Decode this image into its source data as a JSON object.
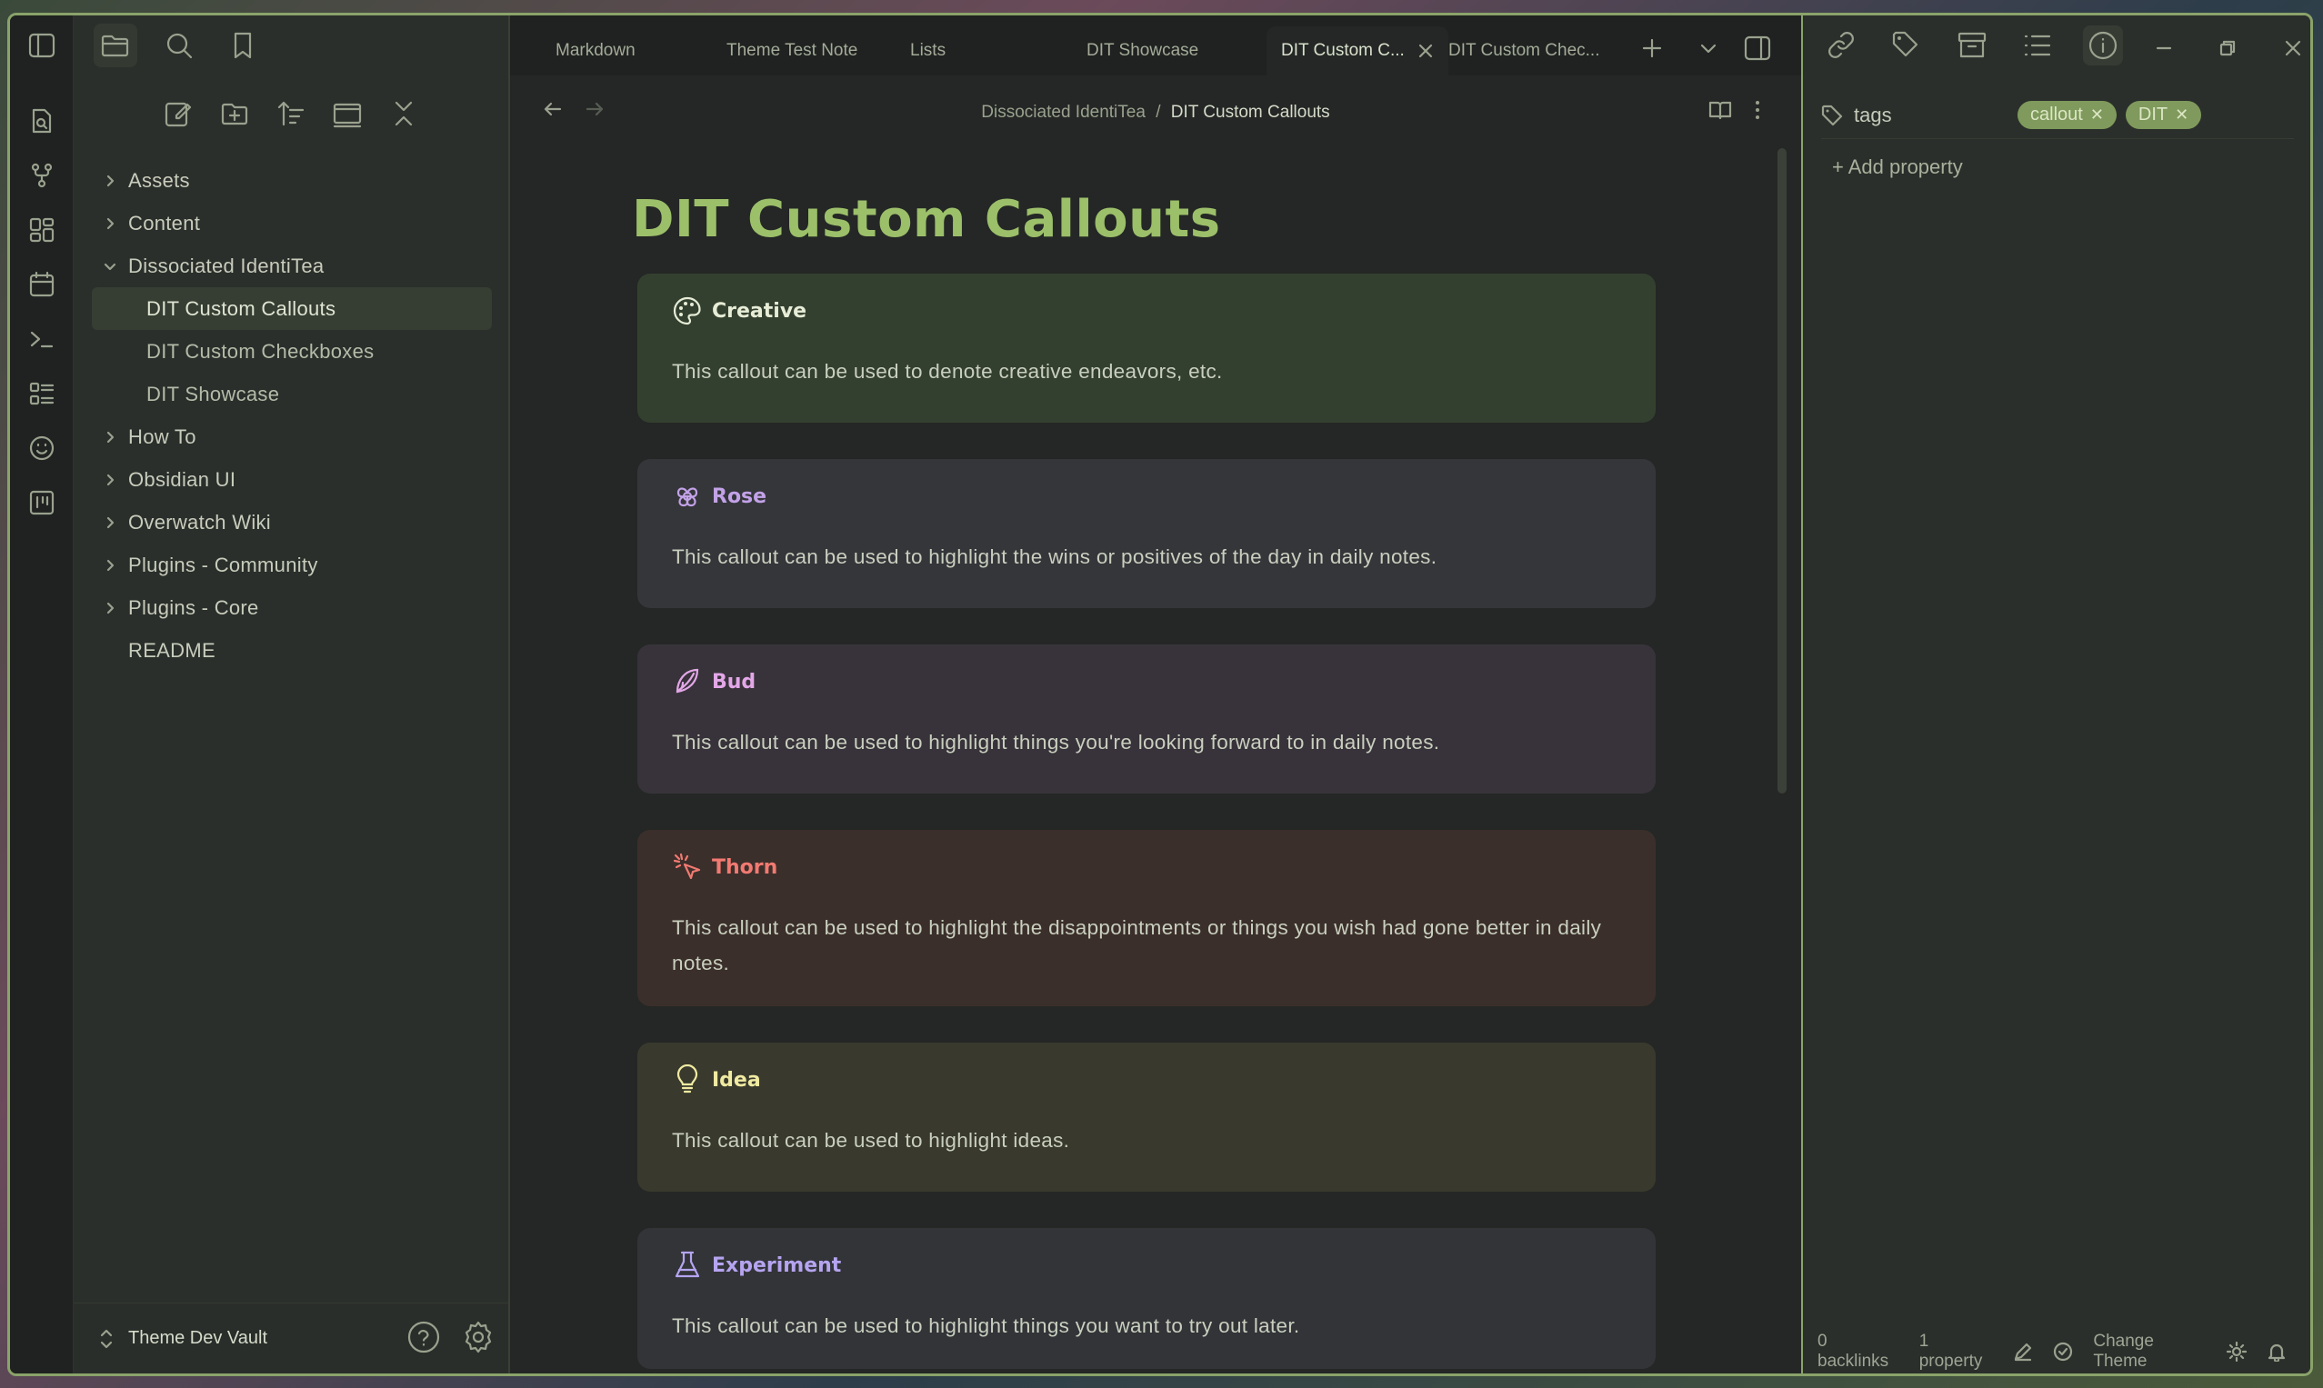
{
  "colors": {
    "accent": "#9cbf6a",
    "creative": "#e6ecd6",
    "rose": "#c3a2e8",
    "bud": "#e3a7e8",
    "thorn": "#f27a72",
    "idea": "#f0eaa2",
    "experiment": "#b6a4f0"
  },
  "tabs": [
    {
      "label": "Markdown"
    },
    {
      "label": "Theme Test Note"
    },
    {
      "label": "Lists"
    },
    {
      "label": "DIT Showcase"
    },
    {
      "label": "DIT Custom C..."
    },
    {
      "label": "DIT Custom Chec..."
    }
  ],
  "sidebar": {
    "items": [
      {
        "label": "Assets"
      },
      {
        "label": "Content"
      },
      {
        "label": "Dissociated IdentiTea"
      },
      {
        "label": "DIT Custom Callouts"
      },
      {
        "label": "DIT Custom Checkboxes"
      },
      {
        "label": "DIT Showcase"
      },
      {
        "label": "How To"
      },
      {
        "label": "Obsidian UI"
      },
      {
        "label": "Overwatch Wiki"
      },
      {
        "label": "Plugins - Community"
      },
      {
        "label": "Plugins - Core"
      },
      {
        "label": "README"
      }
    ],
    "vault_name": "Theme Dev Vault"
  },
  "breadcrumb": {
    "parent": "Dissociated IdentiTea",
    "separator": "/",
    "current": "DIT Custom Callouts"
  },
  "page": {
    "title": "DIT Custom Callouts"
  },
  "callouts": [
    {
      "icon": "palette-icon",
      "title": "Creative",
      "body": "This callout can be used to denote creative endeavors, etc."
    },
    {
      "icon": "flower-icon",
      "title": "Rose",
      "body": "This callout can be used to highlight the wins or positives of the day in daily notes."
    },
    {
      "icon": "bud-icon",
      "title": "Bud",
      "body": "This callout can be used to highlight things you're looking forward to in daily notes."
    },
    {
      "icon": "thorn-icon",
      "title": "Thorn",
      "body": "This callout can be used to highlight the disappointments or things you wish had gone better in daily notes."
    },
    {
      "icon": "lightbulb-icon",
      "title": "Idea",
      "body": "This callout can be used to highlight ideas."
    },
    {
      "icon": "flask-icon",
      "title": "Experiment",
      "body": "This callout can be used to highlight things you want to try out later."
    }
  ],
  "properties": {
    "key": "tags",
    "tags": [
      "callout",
      "DIT"
    ],
    "add_label": "+ Add property"
  },
  "status": {
    "backlinks": "0 backlinks",
    "properties": "1 property",
    "change_theme": "Change Theme"
  }
}
